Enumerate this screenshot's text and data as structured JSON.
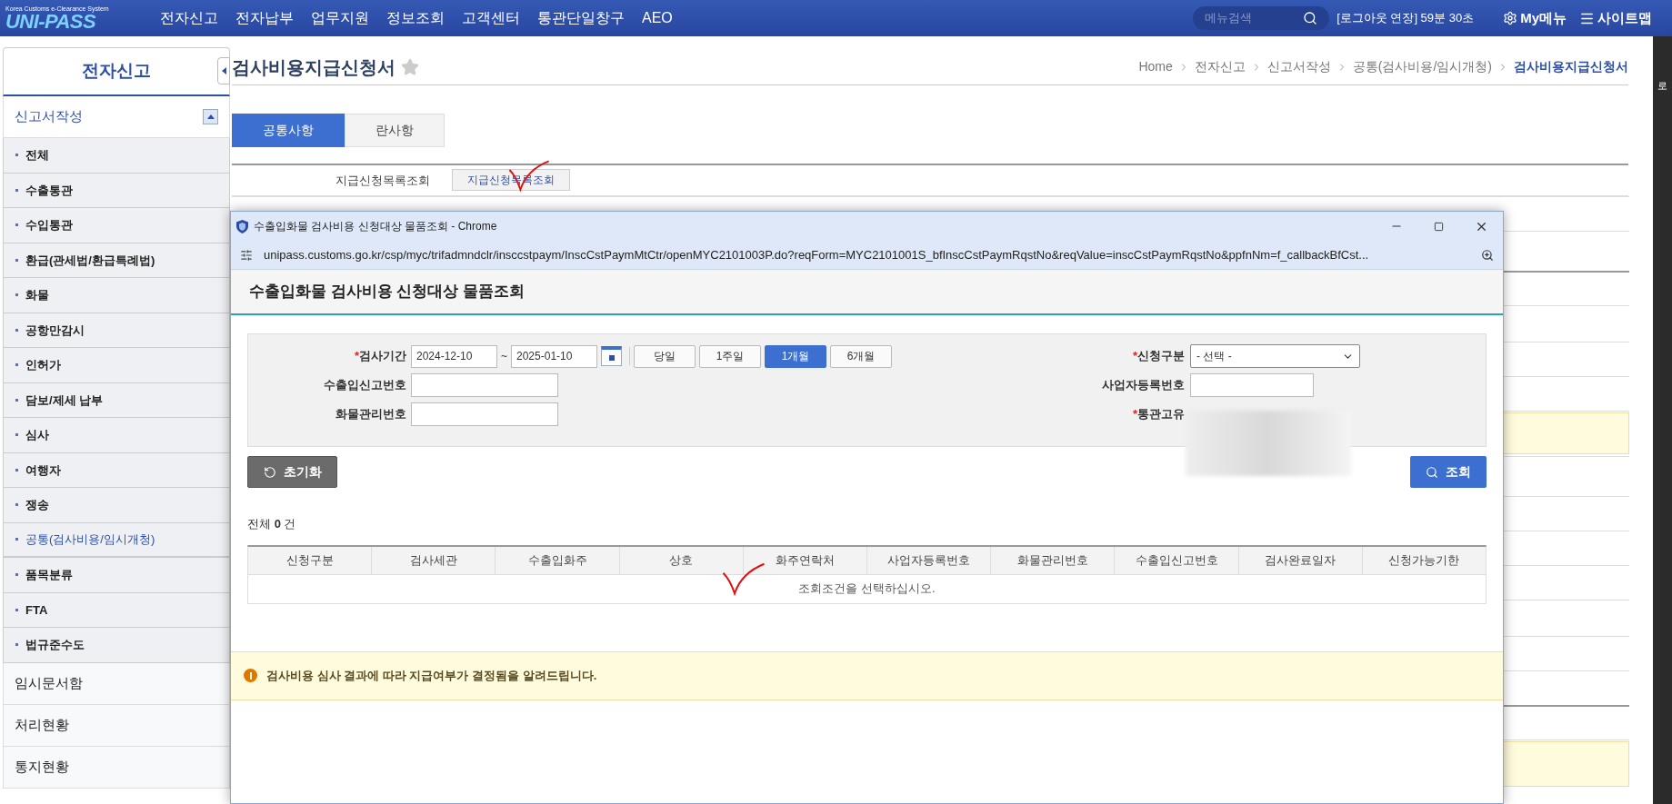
{
  "top_nav": {
    "logo_title": "UNI-PASS",
    "logo_subtitle": "Korea Customs e-Clearance System",
    "menu": [
      "전자신고",
      "전자납부",
      "업무지원",
      "정보조회",
      "고객센터",
      "통관단일창구",
      "AEO"
    ],
    "search": {
      "placeholder": "메뉴검색"
    },
    "session": "[로그아웃 연장] 59분 30초",
    "my_menu": "My메뉴",
    "sitemap": "사이트맵"
  },
  "sidebar": {
    "title": "전자신고",
    "section": {
      "label": "신고서작성",
      "expanded": true
    },
    "items": [
      {
        "label": "전체",
        "selected": false
      },
      {
        "label": "수출통관",
        "selected": false
      },
      {
        "label": "수입통관",
        "selected": false
      },
      {
        "label": "환급(관세법/환급특례법)",
        "selected": false
      },
      {
        "label": "화물",
        "selected": false
      },
      {
        "label": "공항만감시",
        "selected": false
      },
      {
        "label": "인허가",
        "selected": false
      },
      {
        "label": "담보/제세 납부",
        "selected": false
      },
      {
        "label": "심사",
        "selected": false
      },
      {
        "label": "여행자",
        "selected": false
      },
      {
        "label": "쟁송",
        "selected": false
      },
      {
        "label": "공통(검사비용/임시개청)",
        "selected": true
      },
      {
        "label": "품목분류",
        "selected": false
      },
      {
        "label": "FTA",
        "selected": false
      },
      {
        "label": "법규준수도",
        "selected": false
      }
    ],
    "links": [
      "임시문서함",
      "처리현황",
      "통지현황"
    ]
  },
  "page": {
    "title": "검사비용지급신청서",
    "favorite": false,
    "breadcrumb": [
      "Home",
      "전자신고",
      "신고서작성",
      "공통(검사비용/임시개청)",
      "검사비용지급신청서"
    ],
    "tabs": [
      {
        "label": "공통사항",
        "selected": true
      },
      {
        "label": "란사항",
        "selected": false
      }
    ],
    "row_label": "지급신청목록조회",
    "row_button": "지급신청목록조회"
  },
  "popup": {
    "window_title": "수출입화물 검사비용 신청대상 물품조회 - Chrome",
    "url": "unipass.customs.go.kr/csp/myc/trifadmndclr/insccstpaym/InscCstPaymMtCtr/openMYC2101003P.do?reqForm=MYC2101001S_bfInscCstPaymRqstNo&reqValue=inscCstPaymRqstNo&ppfnNm=f_callbackBfCst...",
    "heading": "수출입화물 검사비용 신청대상 물품조회",
    "required_mark": "*",
    "period": {
      "label": "검사기간",
      "required": true,
      "from": "2024-12-10",
      "separator": "~",
      "to": "2025-01-10"
    },
    "period_buttons": [
      {
        "label": "당일",
        "selected": false
      },
      {
        "label": "1주일",
        "selected": false
      },
      {
        "label": "1개월",
        "selected": true
      },
      {
        "label": "6개월",
        "selected": false
      }
    ],
    "request_type": {
      "label": "신청구분",
      "required": true,
      "value": "- 선택 -"
    },
    "fields": [
      {
        "label": "수출입신고번호",
        "required": false
      },
      {
        "label": "사업자등록번호",
        "required": false
      },
      {
        "label": "화물관리번호",
        "required": false
      },
      {
        "label": "통관고유",
        "required": true
      }
    ],
    "reset_button": "초기화",
    "search_button": "조회",
    "count": "전체 **0** 건",
    "columns": [
      "신청구분",
      "검사세관",
      "수출입화주",
      "상호",
      "화주연락처",
      "사업자등록번호",
      "화물관리번호",
      "수출입신고번호",
      "검사완료일자",
      "신청가능기한"
    ],
    "empty_message": "조회조건을 선택하십시오.",
    "notice": "검사비용 심사 결과에 따라 지급여부가 결정됨을 알려드립니다."
  },
  "edge_window": {
    "text": "로"
  }
}
